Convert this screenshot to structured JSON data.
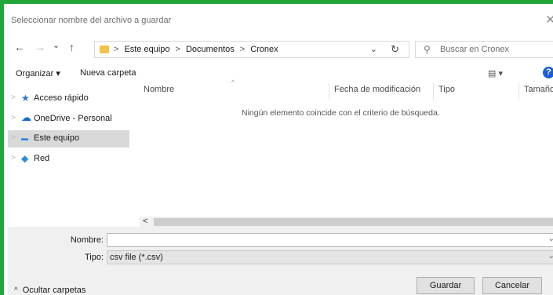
{
  "window": {
    "title": "Seleccionar nombre del archivo a guardar",
    "close_glyph": "✕"
  },
  "nav": {
    "back_glyph": "←",
    "forward_glyph": "→",
    "recent_glyph": "⌄",
    "up_glyph": "↑",
    "breadcrumbs": [
      "Este equipo",
      "Documentos",
      "Cronex"
    ],
    "breadcrumb_sep": ">",
    "refresh_glyph": "↻",
    "search_placeholder": "Buscar en Cronex"
  },
  "toolbar": {
    "organize_label": "Organizar ▾",
    "new_folder_label": "Nueva carpeta",
    "view_glyph": "▤ ▾",
    "help_label": "?"
  },
  "sidebar": {
    "items": [
      {
        "label": "Acceso rápido",
        "icon": "star-icon",
        "icon_glyph": "★",
        "icon_color": "#2a73d9"
      },
      {
        "label": "OneDrive - Personal",
        "icon": "cloud-icon",
        "icon_glyph": "☁",
        "icon_color": "#0f6cc9"
      },
      {
        "label": "Este equipo",
        "icon": "computer-icon",
        "icon_glyph": "▬",
        "icon_color": "#2f8ad8"
      },
      {
        "label": "Red",
        "icon": "network-icon",
        "icon_glyph": "◆",
        "icon_color": "#2f8ad8"
      }
    ],
    "selected_index": 2,
    "chevron_glyph": ">"
  },
  "content": {
    "columns": [
      "Nombre",
      "Fecha de modificación",
      "Tipo",
      "Tamaño"
    ],
    "empty_message": "Ningún elemento coincide con el criterio de búsqueda.",
    "scroll_left_glyph": "<"
  },
  "form": {
    "name_label": "Nombre:",
    "name_value": "",
    "type_label": "Tipo:",
    "type_value": "csv file (*.csv)",
    "dropdown_glyph": "⌄"
  },
  "footer": {
    "hide_folders_label": "Ocultar carpetas",
    "hide_glyph": "^",
    "save_label": "Guardar",
    "cancel_label": "Cancelar"
  },
  "colors": {
    "frame_border": "#22a83a",
    "sidebar_selected": "#d9d9d9",
    "accent": "#1a5fd6"
  }
}
